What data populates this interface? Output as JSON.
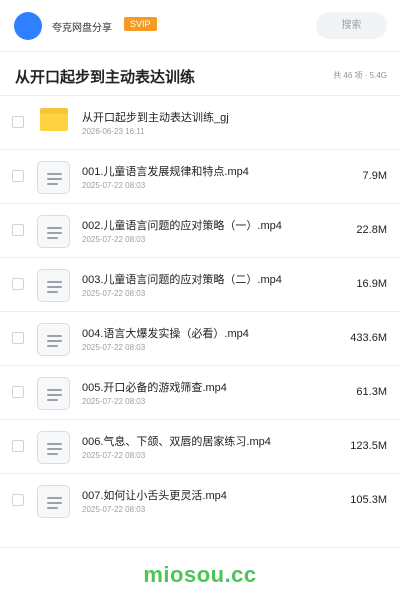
{
  "header": {
    "brand": "夸克网盘分享",
    "badge": "SVIP",
    "search_placeholder": "搜索"
  },
  "page": {
    "title": "从开口起步到主动表达训练",
    "summary": "共 46 项 · 5.4G"
  },
  "files": [
    {
      "type": "folder",
      "name": "从开口起步到主动表达训练_gj",
      "date": "2026-06-23 16:11",
      "size": ""
    },
    {
      "type": "file",
      "name": "001.儿童语言发展规律和特点.mp4",
      "date": "2025-07-22 08:03",
      "size": "7.9M"
    },
    {
      "type": "file",
      "name": "002.儿童语言问题的应对策略（一）.mp4",
      "date": "2025-07-22 08:03",
      "size": "22.8M"
    },
    {
      "type": "file",
      "name": "003.儿童语言问题的应对策略（二）.mp4",
      "date": "2025-07-22 08:03",
      "size": "16.9M"
    },
    {
      "type": "file",
      "name": "004.语言大爆发实操（必看）.mp4",
      "date": "2025-07-22 08:03",
      "size": "433.6M"
    },
    {
      "type": "file",
      "name": "005.开口必备的游戏筛查.mp4",
      "date": "2025-07-22 08:03",
      "size": "61.3M"
    },
    {
      "type": "file",
      "name": "006.气息、下颌、双唇的居家练习.mp4",
      "date": "2025-07-22 08:03",
      "size": "123.5M"
    },
    {
      "type": "file",
      "name": "007.如何让小舌头更灵活.mp4",
      "date": "2025-07-22 08:03",
      "size": "105.3M"
    }
  ],
  "watermark": "miosou.cc"
}
